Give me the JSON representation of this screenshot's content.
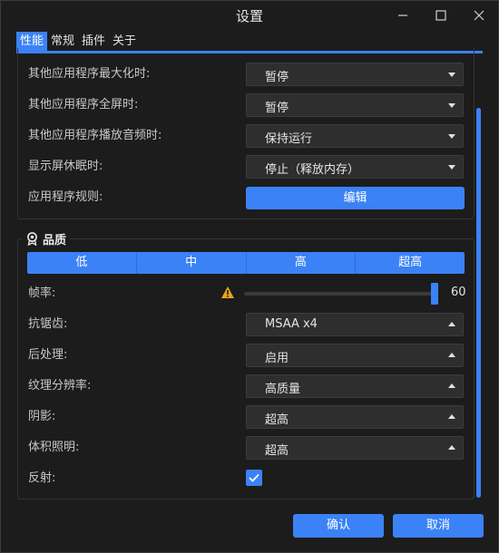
{
  "window": {
    "title": "设置",
    "minimize_icon": "minimize-icon",
    "maximize_icon": "maximize-icon",
    "close_icon": "close-icon"
  },
  "tabs": [
    {
      "label": "性能",
      "active": true
    },
    {
      "label": "常规",
      "active": false
    },
    {
      "label": "插件",
      "active": false
    },
    {
      "label": "关于",
      "active": false
    }
  ],
  "behavior": {
    "rows": [
      {
        "label": "其他应用程序最大化时:",
        "value": "暂停"
      },
      {
        "label": "其他应用程序全屏时:",
        "value": "暂停"
      },
      {
        "label": "其他应用程序播放音频时:",
        "value": "保持运行"
      },
      {
        "label": "显示屏休眠时:",
        "value": "停止（释放内存）"
      }
    ],
    "rules_label": "应用程序规则:",
    "edit_button": "编辑"
  },
  "quality": {
    "title": "品质",
    "icon": "medal-icon",
    "presets": [
      "低",
      "中",
      "高",
      "超高"
    ],
    "fps_label": "帧率:",
    "fps_value": "60",
    "fps_level": 1.0,
    "warning_icon": "warning-icon",
    "rows": [
      {
        "label": "抗锯齿:",
        "value": "MSAA x4"
      },
      {
        "label": "后处理:",
        "value": "启用"
      },
      {
        "label": "纹理分辨率:",
        "value": "高质量"
      },
      {
        "label": "阴影:",
        "value": "超高"
      },
      {
        "label": "体积照明:",
        "value": "超高"
      }
    ],
    "reflection_label": "反射:",
    "reflection_checked": true
  },
  "footer": {
    "ok": "确认",
    "cancel": "取消"
  },
  "colors": {
    "accent": "#3b82f6",
    "warning": "#e8a21c"
  }
}
